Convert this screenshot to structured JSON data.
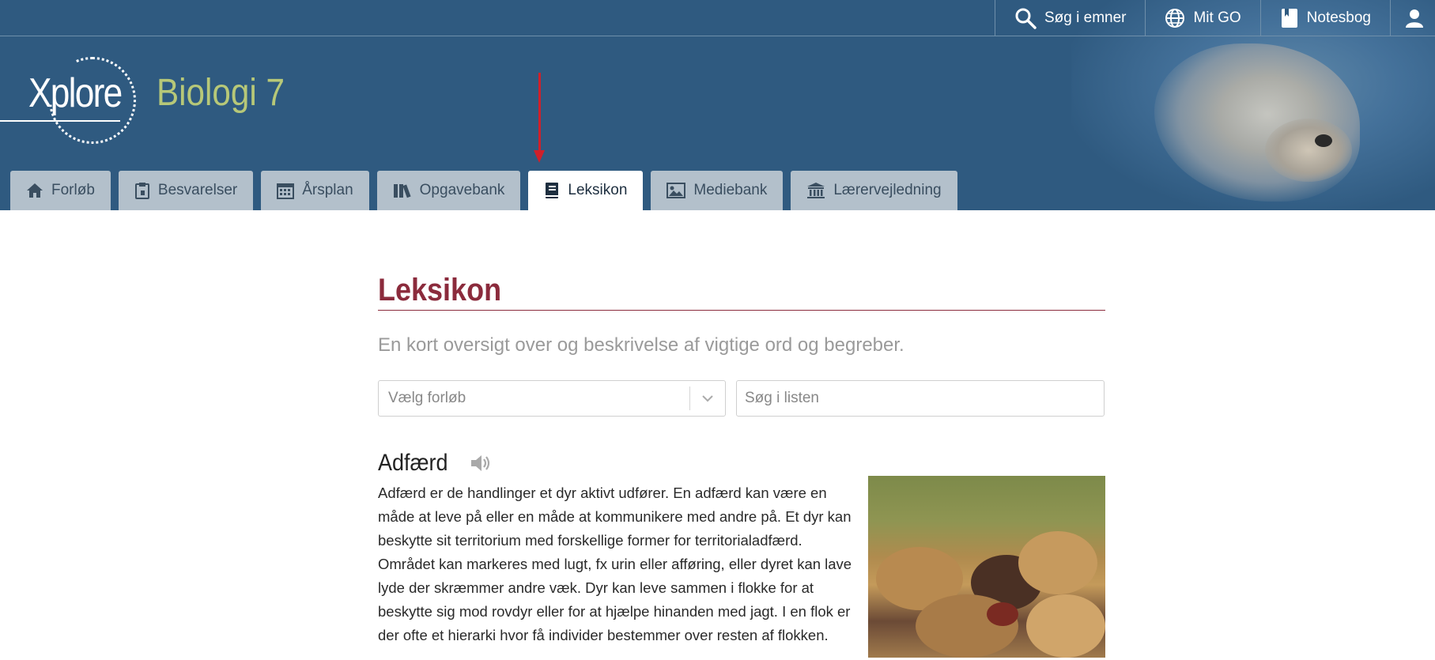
{
  "topnav": {
    "search_label": "Søg i emner",
    "mitgo_label": "Mit GO",
    "notebook_label": "Notesbog"
  },
  "brand": {
    "logo_text": "Xplore",
    "app_title": "Biologi 7",
    "header_color": "#2f5a80",
    "title_color": "#b7c878"
  },
  "tabs": [
    {
      "label": "Forløb",
      "icon": "home-icon"
    },
    {
      "label": "Besvarelser",
      "icon": "clipboard-icon"
    },
    {
      "label": "Årsplan",
      "icon": "calendar-icon"
    },
    {
      "label": "Opgavebank",
      "icon": "library-icon"
    },
    {
      "label": "Leksikon",
      "icon": "book-icon",
      "active": true
    },
    {
      "label": "Mediebank",
      "icon": "image-icon"
    },
    {
      "label": "Lærervejledning",
      "icon": "institution-icon"
    }
  ],
  "main": {
    "title": "Leksikon",
    "subtitle": "En kort oversigt over og beskrivelse af vigtige ord og begreber.",
    "select_placeholder": "Vælg forløb",
    "search_placeholder": "Søg i listen",
    "accent_color": "#8b2b3c"
  },
  "entry": {
    "title": "Adfærd",
    "text": "Adfærd er de handlinger et dyr aktivt udfører. En adfærd kan være en måde at leve på eller en måde at kommunikere med andre på. Et dyr kan beskytte sit territorium med forskellige former for territorialadfærd. Området kan markeres med lugt, fx urin eller afføring, eller dyret kan lave lyde der skræmmer andre væk. Dyr kan leve sammen i flokke for at beskytte sig mod rovdyr eller for at hjælpe hinanden med jagt. I en flok er der ofte et hierarki hvor få individer bestemmer over resten af flokken."
  }
}
